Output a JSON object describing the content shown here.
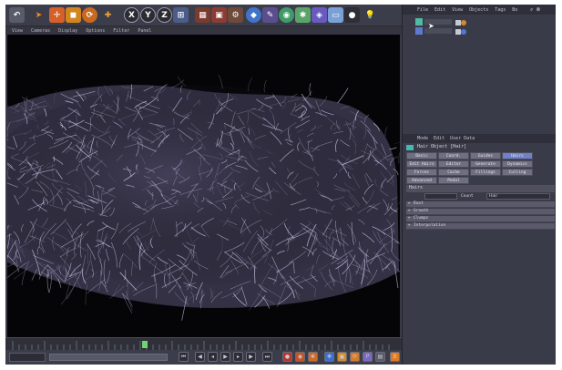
{
  "viewport_menu": [
    "View",
    "Cameras",
    "Display",
    "Options",
    "Filter",
    "Panel"
  ],
  "object_manager_menu": [
    "File",
    "Edit",
    "View",
    "Objects",
    "Tags",
    "Bo"
  ],
  "attribute_manager": {
    "menu": [
      "Mode",
      "Edit",
      "User Data"
    ],
    "title": "Hair Object [Hair]",
    "tabs": [
      [
        "Basic",
        "Coord.",
        "Guides",
        "Hairs"
      ],
      [
        "Edit Hairs",
        "Editor",
        "Generate",
        "Dynamics"
      ],
      [
        "Forces",
        "Cache",
        "Fillings",
        "Culling"
      ],
      [
        "Advanced",
        "Pedal"
      ]
    ],
    "active_tab": "Hairs",
    "section_title": "Hairs",
    "field_label": "Count",
    "field_value": "Hair",
    "folds": [
      "Root",
      "Growth",
      "Clumps",
      "Interpolation"
    ]
  },
  "timeline": {
    "current_frame": "0 F"
  },
  "colors": {
    "accent": "#6f82c9",
    "ui_bg": "#3a3b47",
    "viewport_bg": "#050507",
    "hair": "#c9c3e6"
  },
  "icons": [
    "select-icon",
    "move-icon",
    "scale-icon",
    "rotate-icon",
    "axis-x-icon",
    "axis-y-icon",
    "axis-z-icon",
    "world-coord-icon",
    "render-icon",
    "light-icon"
  ]
}
